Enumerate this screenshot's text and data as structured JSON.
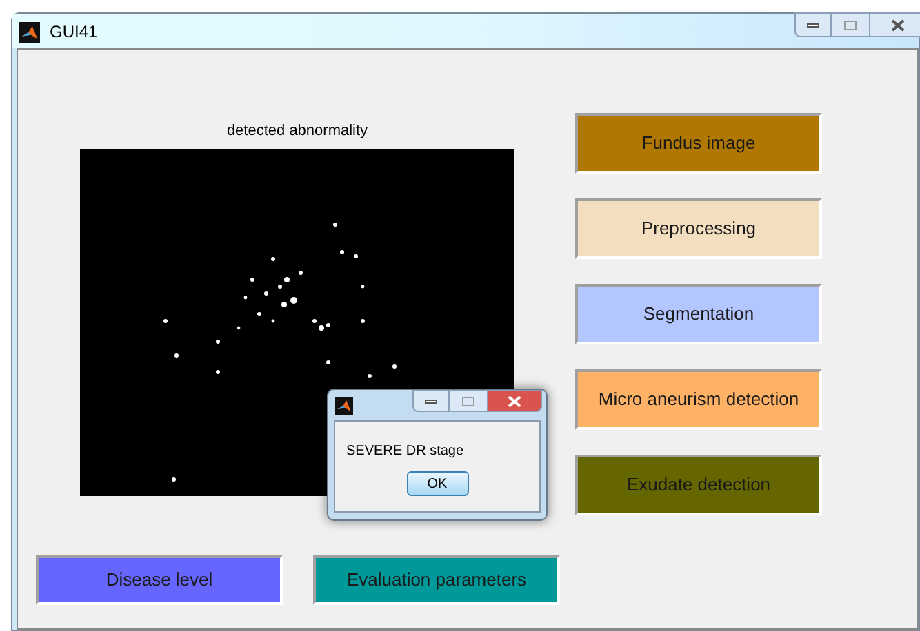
{
  "window": {
    "title": "GUI41"
  },
  "axes": {
    "title": "detected abnormality",
    "kind": "picture"
  },
  "side_buttons": [
    {
      "label": "Fundus image",
      "color": "#b07800"
    },
    {
      "label": "Preprocessing",
      "color": "#f3dfbf"
    },
    {
      "label": "Segmentation",
      "color": "#b3c6ff"
    },
    {
      "label": "Micro aneurism detection",
      "color": "#ffb266"
    },
    {
      "label": "Exudate detection",
      "color": "#666600"
    }
  ],
  "bottom_buttons": [
    {
      "label": "Disease level",
      "color": "#6666ff"
    },
    {
      "label": "Evaluation parameters",
      "color": "#009999"
    }
  ],
  "dialog": {
    "message": "SEVERE DR stage",
    "button": "OK"
  }
}
